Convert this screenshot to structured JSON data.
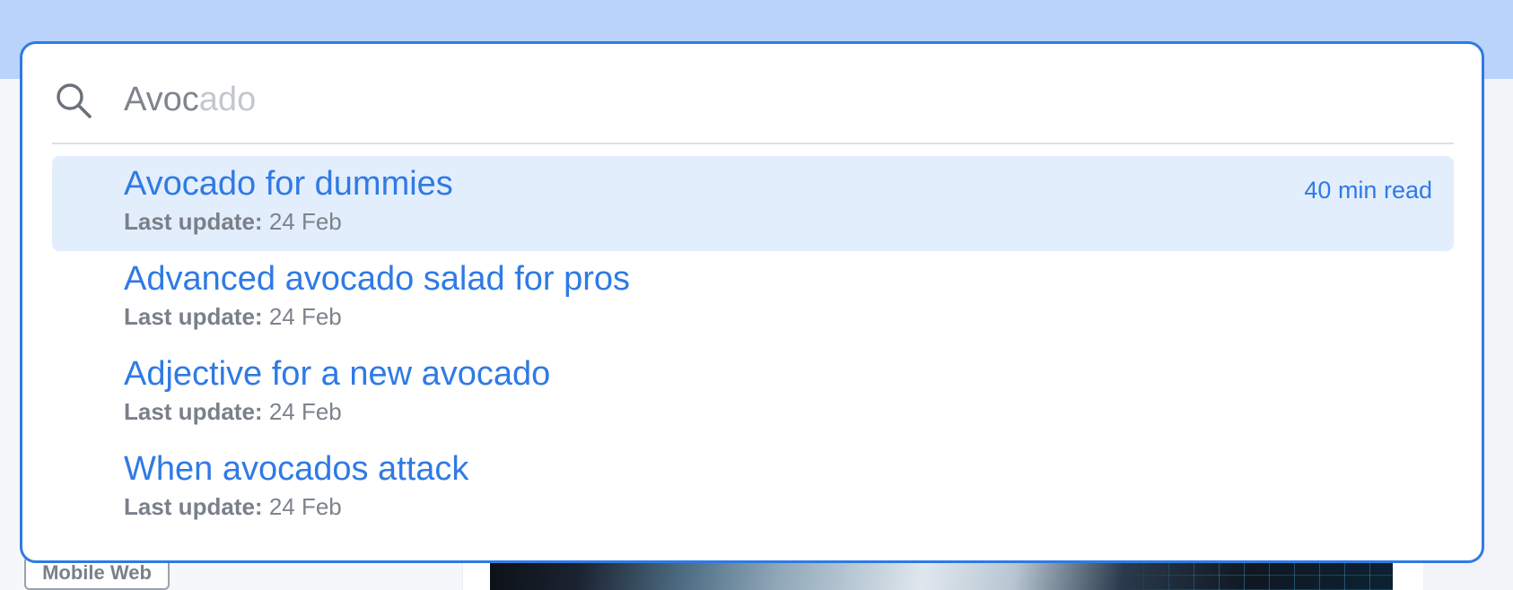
{
  "background": {
    "tag_label": "Mobile Web"
  },
  "search": {
    "typed": "Avoc",
    "suggestion": "ado",
    "icon": "search-icon"
  },
  "results": [
    {
      "title": "Avocado for dummies",
      "meta_label": "Last update:",
      "meta_value": "24 Feb",
      "read_time": "40 min read",
      "active": true
    },
    {
      "title": "Advanced avocado salad for pros",
      "meta_label": "Last update:",
      "meta_value": "24 Feb"
    },
    {
      "title": "Adjective for a new avocado",
      "meta_label": "Last update:",
      "meta_value": "24 Feb"
    },
    {
      "title": "When avocados attack",
      "meta_label": "Last update:",
      "meta_value": "24 Feb"
    }
  ],
  "colors": {
    "accent": "#2f7ae5",
    "active_row": "#e3eefc",
    "top_band": "#b9d3fb",
    "muted_text": "#7d838c"
  }
}
